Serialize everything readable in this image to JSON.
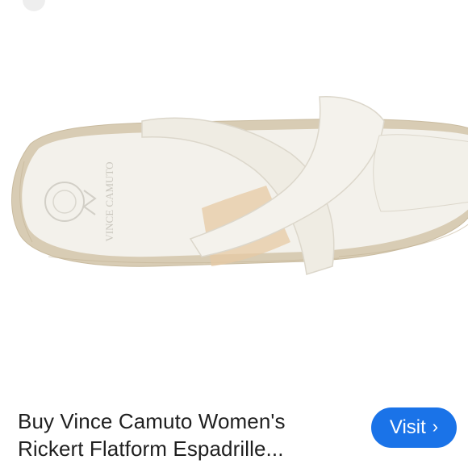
{
  "caption": {
    "line1": "Buy Vince Camuto Women's",
    "line2": "Rickert Flatform Espadrille..."
  },
  "visit_button": {
    "label": "Visit",
    "icon": "chevron-right-icon",
    "color": "#1a73e8"
  },
  "product_image": {
    "insole_logo_text": "VINCE CAMUTO",
    "sandal_color": "#f1eee6",
    "jute_color": "#d8ccb4"
  }
}
